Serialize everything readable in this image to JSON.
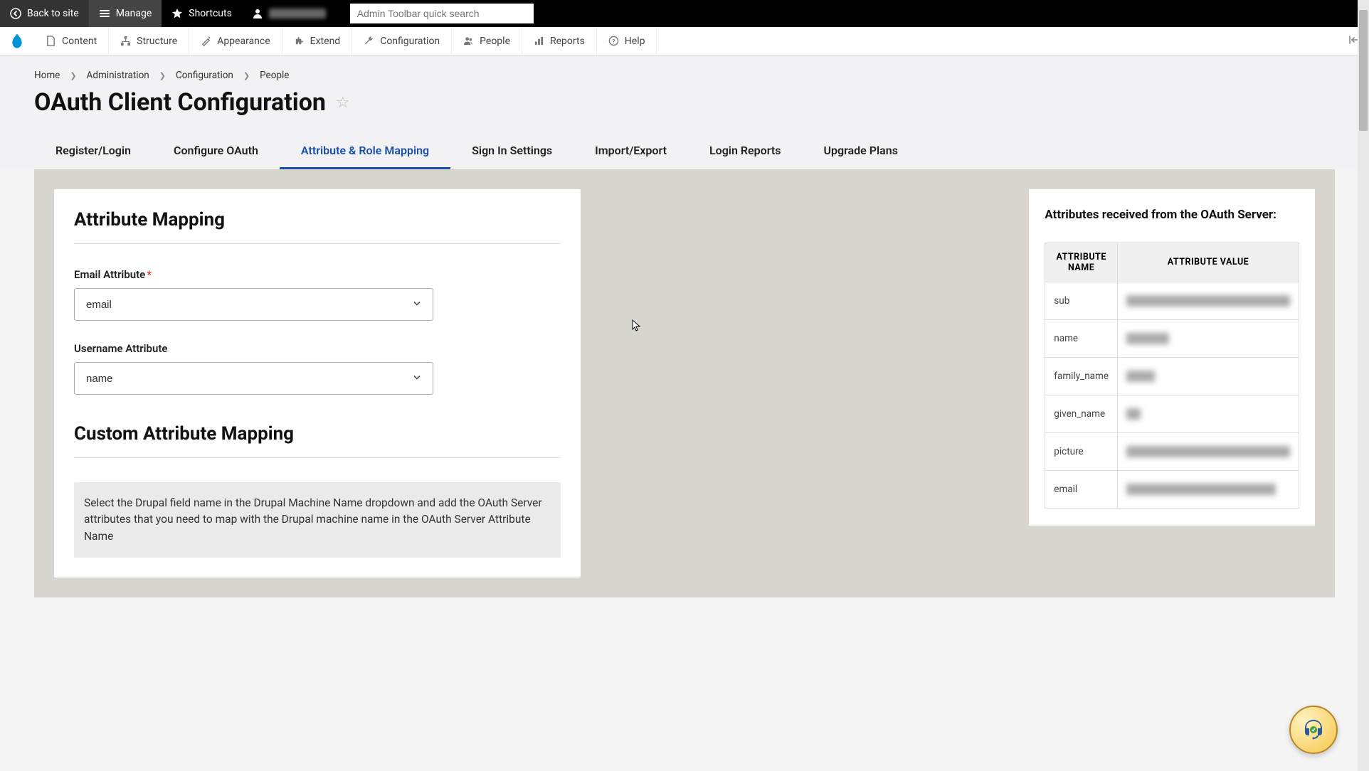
{
  "top_toolbar": {
    "back": "Back to site",
    "manage": "Manage",
    "shortcuts": "Shortcuts",
    "search_placeholder": "Admin Toolbar quick search"
  },
  "secondary_nav": {
    "items": [
      {
        "label": "Content"
      },
      {
        "label": "Structure"
      },
      {
        "label": "Appearance"
      },
      {
        "label": "Extend"
      },
      {
        "label": "Configuration"
      },
      {
        "label": "People"
      },
      {
        "label": "Reports"
      },
      {
        "label": "Help"
      }
    ]
  },
  "breadcrumb": {
    "items": [
      "Home",
      "Administration",
      "Configuration",
      "People"
    ]
  },
  "page_title": "OAuth Client Configuration",
  "tabs": [
    {
      "label": "Register/Login"
    },
    {
      "label": "Configure OAuth"
    },
    {
      "label": "Attribute & Role Mapping",
      "active": true
    },
    {
      "label": "Sign In Settings"
    },
    {
      "label": "Import/Export"
    },
    {
      "label": "Login Reports"
    },
    {
      "label": "Upgrade Plans"
    }
  ],
  "attribute_mapping": {
    "heading": "Attribute Mapping",
    "email_label": "Email Attribute",
    "email_value": "email",
    "username_label": "Username Attribute",
    "username_value": "name"
  },
  "custom_mapping": {
    "heading": "Custom Attribute Mapping",
    "info": "Select the Drupal field name in the Drupal Machine Name dropdown and add the OAuth Server attributes that you need to map with the Drupal machine name in the OAuth Server Attribute Name"
  },
  "right_panel": {
    "heading": "Attributes received from the OAuth Server:",
    "col1": "ATTRIBUTE NAME",
    "col2": "ATTRIBUTE VALUE",
    "rows": [
      {
        "name": "sub"
      },
      {
        "name": "name"
      },
      {
        "name": "family_name"
      },
      {
        "name": "given_name"
      },
      {
        "name": "picture"
      },
      {
        "name": "email"
      }
    ]
  }
}
